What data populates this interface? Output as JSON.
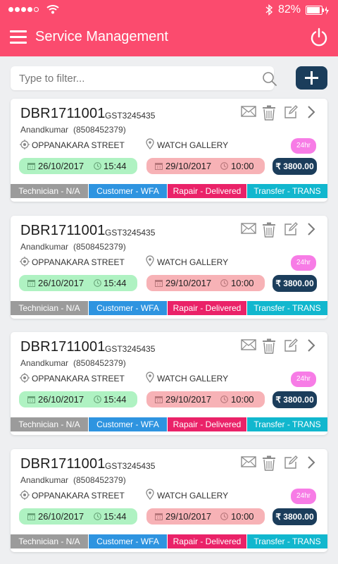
{
  "status_bar": {
    "battery": "82%"
  },
  "header": {
    "title": "Service Management"
  },
  "filter": {
    "placeholder": "Type to filter..."
  },
  "colors": {
    "brand": "#fb4b6e",
    "navy": "#1b3d5b",
    "technician": "#9b9b9b",
    "customer": "#2e94e0",
    "repair": "#ea2268",
    "transfer": "#11b7ce",
    "sla": "#f77ce6"
  },
  "cards": [
    {
      "id": "DBR1711001",
      "gst": "GST3245435",
      "customer_name": "Anandkumar",
      "phone": "(8508452379)",
      "street": "OPPANAKARA STREET",
      "store": "WATCH GALLERY",
      "sla": "24hr",
      "start_date": "26/10/2017",
      "start_time": "15:44",
      "end_date": "29/10/2017",
      "end_time": "10:00",
      "price": "₹ 3800.00",
      "technician": "Technician - N/A",
      "customer_status": "Customer - WFA",
      "repair_status": "Rapair - Delivered",
      "transfer_status": "Transfer - TRANS"
    },
    {
      "id": "DBR1711001",
      "gst": "GST3245435",
      "customer_name": "Anandkumar",
      "phone": "(8508452379)",
      "street": "OPPANAKARA STREET",
      "store": "WATCH GALLERY",
      "sla": "24hr",
      "start_date": "26/10/2017",
      "start_time": "15:44",
      "end_date": "29/10/2017",
      "end_time": "10:00",
      "price": "₹ 3800.00",
      "technician": "Technician - N/A",
      "customer_status": "Customer - WFA",
      "repair_status": "Rapair - Delivered",
      "transfer_status": "Transfer - TRANS"
    },
    {
      "id": "DBR1711001",
      "gst": "GST3245435",
      "customer_name": "Anandkumar",
      "phone": "(8508452379)",
      "street": "OPPANAKARA STREET",
      "store": "WATCH GALLERY",
      "sla": "24hr",
      "start_date": "26/10/2017",
      "start_time": "15:44",
      "end_date": "29/10/2017",
      "end_time": "10:00",
      "price": "₹ 3800.00",
      "technician": "Technician - N/A",
      "customer_status": "Customer - WFA",
      "repair_status": "Rapair - Delivered",
      "transfer_status": "Transfer - TRANS"
    },
    {
      "id": "DBR1711001",
      "gst": "GST3245435",
      "customer_name": "Anandkumar",
      "phone": "(8508452379)",
      "street": "OPPANAKARA STREET",
      "store": "WATCH GALLERY",
      "sla": "24hr",
      "start_date": "26/10/2017",
      "start_time": "15:44",
      "end_date": "29/10/2017",
      "end_time": "10:00",
      "price": "₹ 3800.00",
      "technician": "Technician - N/A",
      "customer_status": "Customer - WFA",
      "repair_status": "Rapair - Delivered",
      "transfer_status": "Transfer - TRANS"
    }
  ]
}
